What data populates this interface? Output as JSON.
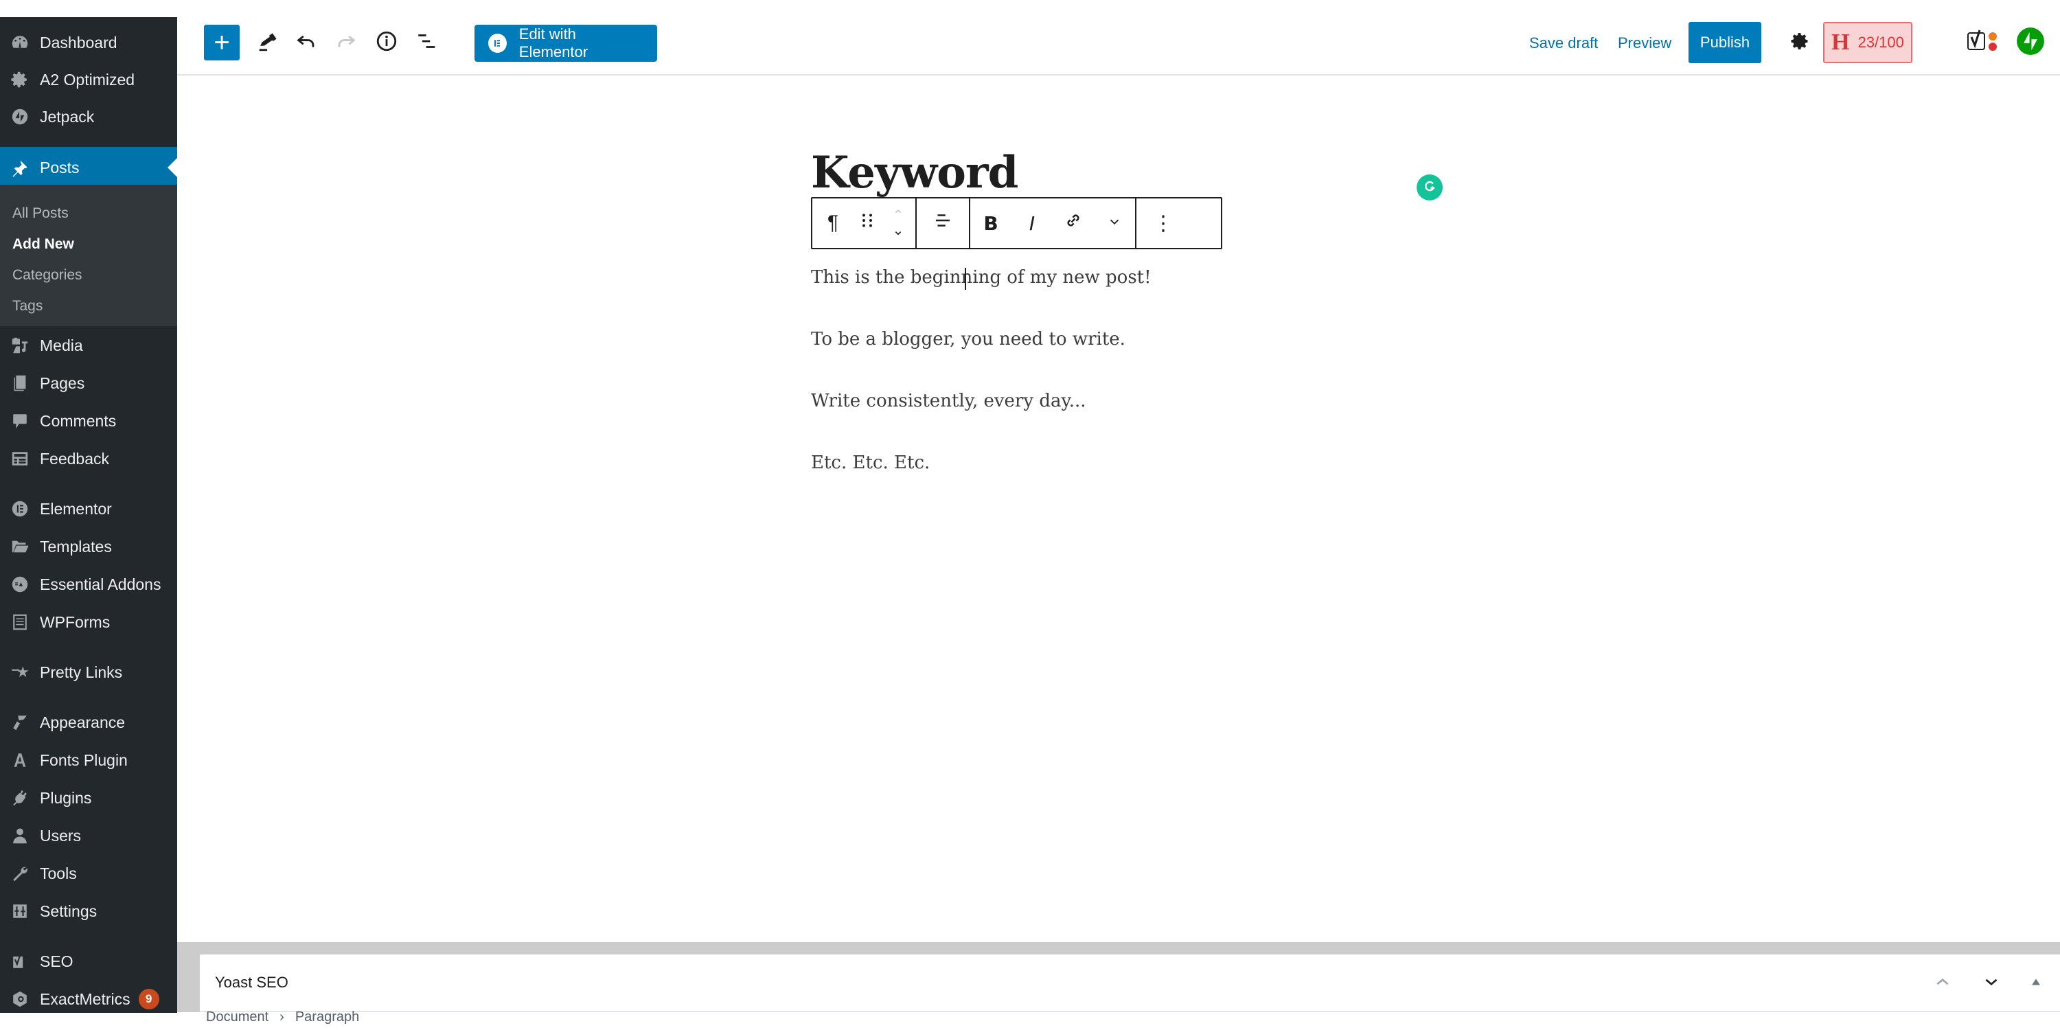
{
  "sidebar": {
    "items": [
      {
        "label": "Dashboard",
        "icon": "dashboard-icon"
      },
      {
        "label": "A2 Optimized",
        "icon": "gear-icon"
      },
      {
        "label": "Jetpack",
        "icon": "jetpack-icon"
      },
      {
        "label": "Posts",
        "icon": "pin-icon",
        "active": true
      },
      {
        "label": "Media",
        "icon": "media-icon"
      },
      {
        "label": "Pages",
        "icon": "pages-icon"
      },
      {
        "label": "Comments",
        "icon": "comment-icon"
      },
      {
        "label": "Feedback",
        "icon": "feedback-icon"
      },
      {
        "label": "Elementor",
        "icon": "elementor-icon"
      },
      {
        "label": "Templates",
        "icon": "folder-icon"
      },
      {
        "label": "Essential Addons",
        "icon": "essential-addons-icon"
      },
      {
        "label": "WPForms",
        "icon": "wpforms-icon"
      },
      {
        "label": "Pretty Links",
        "icon": "star-icon"
      },
      {
        "label": "Appearance",
        "icon": "brush-icon"
      },
      {
        "label": "Fonts Plugin",
        "icon": "font-icon"
      },
      {
        "label": "Plugins",
        "icon": "plug-icon"
      },
      {
        "label": "Users",
        "icon": "user-icon"
      },
      {
        "label": "Tools",
        "icon": "wrench-icon"
      },
      {
        "label": "Settings",
        "icon": "settings-icon"
      },
      {
        "label": "SEO",
        "icon": "yoast-icon"
      },
      {
        "label": "ExactMetrics",
        "icon": "exactmetrics-icon",
        "badge": "9"
      }
    ],
    "posts_submenu": [
      {
        "label": "All Posts"
      },
      {
        "label": "Add New",
        "current": true
      },
      {
        "label": "Categories"
      },
      {
        "label": "Tags"
      }
    ]
  },
  "toolbar": {
    "add_block": "+",
    "edit_with_elementor": "Edit with Elementor",
    "save_draft": "Save draft",
    "preview": "Preview",
    "publish": "Publish",
    "score_letter": "H",
    "score": "23/100"
  },
  "editor": {
    "title": "Keyword",
    "block_toolbar": {
      "paragraph_symbol": "¶",
      "bold": "B",
      "italic": "I",
      "more": "⋮"
    },
    "paragraphs": [
      "This is the beginning of my new post!",
      "To be a blogger, you need to write.",
      "Write consistently, every day...",
      "Etc. Etc. Etc."
    ]
  },
  "metabox": {
    "title": "Yoast SEO"
  },
  "footer": {
    "breadcrumb": [
      "Document",
      "Paragraph"
    ],
    "separator": "›"
  },
  "colors": {
    "sidebar_bg": "#23282d",
    "submenu_bg": "#32373c",
    "accent": "#0073aa",
    "button": "#007cba",
    "score_bg": "#f8d4d4",
    "score_text": "#d63638",
    "badge": "#ca4a1f",
    "grammarly": "#15c39a",
    "jetpack": "#069e08"
  }
}
